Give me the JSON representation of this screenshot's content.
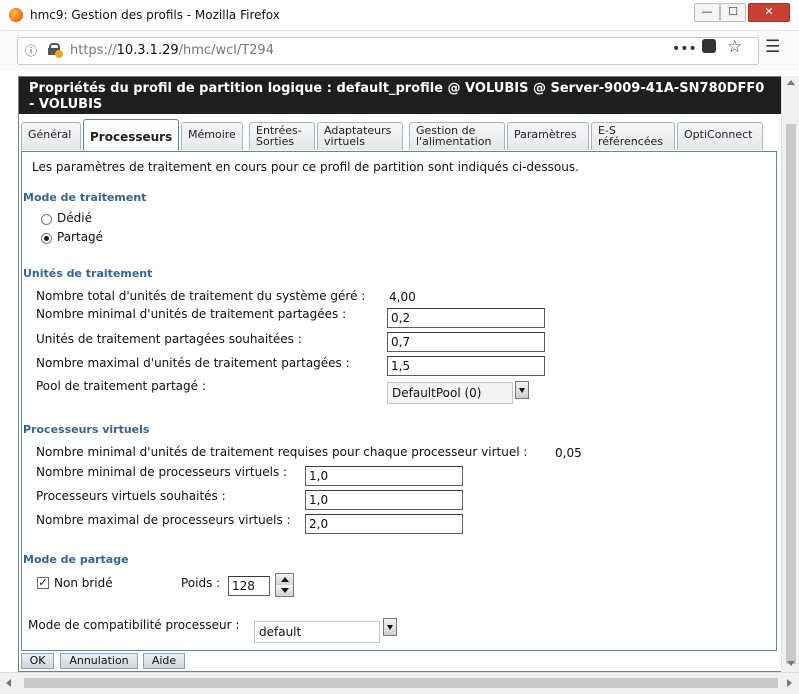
{
  "window": {
    "title": "hmc9: Gestion des profils - Mozilla Firefox",
    "minimize": "—",
    "maximize": "☐",
    "close": "✕"
  },
  "urlbar": {
    "url_scheme": "https://",
    "url_host": "10.3.1.29",
    "url_path": "/hmc/wcl/T294"
  },
  "dialog": {
    "title": "Propriétés du profil de partition logique : default_profile @ VOLUBIS @ Server-9009-41A-SN780DFF0 - VOLUBIS",
    "tabs": [
      {
        "label": "Général"
      },
      {
        "label": "Processeurs"
      },
      {
        "label": "Mémoire"
      },
      {
        "label": "Entrées-Sorties"
      },
      {
        "label": "Adaptateurs virtuels"
      },
      {
        "label": "Gestion de l'alimentation"
      },
      {
        "label": "Paramètres"
      },
      {
        "label": "E-S référencées"
      },
      {
        "label": "OptiConnect"
      }
    ],
    "active_tab": "Processeurs",
    "intro": "Les paramètres de traitement en cours pour ce profil de partition sont indiqués ci-dessous.",
    "processing_mode": {
      "heading": "Mode de traitement",
      "options": [
        "Dédié",
        "Partagé"
      ],
      "selected": "Partagé"
    },
    "processing_units": {
      "heading": "Unités de traitement",
      "total_label": "Nombre total d'unités de traitement du système géré :",
      "total_value": "4,00",
      "min_label": "Nombre minimal d'unités de traitement partagées :",
      "min_value": "0,2",
      "desired_label": "Unités de traitement partagées souhaitées :",
      "desired_value": "0,7",
      "max_label": "Nombre maximal d'unités de traitement partagées :",
      "max_value": "1,5",
      "pool_label": "Pool de traitement partagé :",
      "pool_value": "DefaultPool (0)"
    },
    "virtual_processors": {
      "heading": "Processeurs virtuels",
      "min_units_label": "Nombre minimal d'unités de traitement requises pour chaque processeur virtuel :",
      "min_units_value": "0,05",
      "min_label": "Nombre minimal de processeurs virtuels :",
      "min_value": "1,0",
      "desired_label": "Processeurs virtuels souhaités :",
      "desired_value": "1,0",
      "max_label": "Nombre maximal de processeurs virtuels :",
      "max_value": "2,0"
    },
    "sharing_mode": {
      "heading": "Mode de partage",
      "uncapped_label": "Non bridé",
      "uncapped_checked": true,
      "weight_label": "Poids :",
      "weight_value": "128"
    },
    "compat": {
      "label": "Mode de compatibilité processeur :",
      "value": "default"
    },
    "buttons": {
      "ok": "OK",
      "cancel": "Annulation",
      "help": "Aide"
    }
  },
  "colors": {
    "header_bg": "#1e1e1e",
    "section_heading": "#39648e",
    "tab_border": "#5b88ab"
  }
}
